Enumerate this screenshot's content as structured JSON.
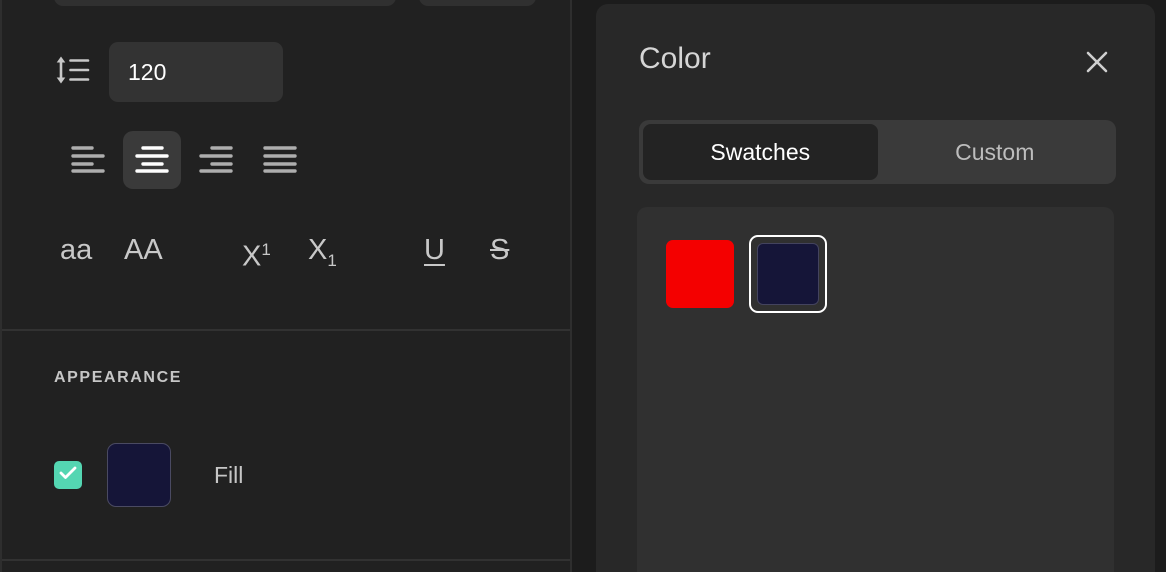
{
  "theme": {
    "app_background": "#1c1c1c",
    "panel_background": "#212121",
    "color_panel_background": "#282828",
    "accent_checkbox": "#54d6b2",
    "text_primary": "#ffffff",
    "text_secondary": "#c6c6c6"
  },
  "inspector": {
    "typography": {
      "line_height_icon": "line-height-icon",
      "line_height_value": "120",
      "line_height_placeholder": "120",
      "alignment": {
        "selected": "center",
        "options": [
          {
            "id": "left",
            "label": "Align left",
            "icon": "align-left-icon",
            "active": false
          },
          {
            "id": "center",
            "label": "Align center",
            "icon": "align-center-icon",
            "active": true
          },
          {
            "id": "right",
            "label": "Align right",
            "icon": "align-right-icon",
            "active": false
          },
          {
            "id": "justify",
            "label": "Justify",
            "icon": "align-justify-icon",
            "active": false
          }
        ]
      },
      "text_styles": [
        {
          "id": "lowercase",
          "label": "aa",
          "icon": "lowercase-icon"
        },
        {
          "id": "uppercase",
          "label": "AA",
          "icon": "uppercase-icon"
        },
        {
          "id": "superscript",
          "base": "X",
          "script": "1",
          "icon": "superscript-icon"
        },
        {
          "id": "subscript",
          "base": "X",
          "script": "1",
          "icon": "subscript-icon"
        },
        {
          "id": "underline",
          "label": "U",
          "icon": "underline-icon"
        },
        {
          "id": "strikethrough",
          "label": "S",
          "icon": "strikethrough-icon"
        }
      ]
    },
    "appearance": {
      "title": "APPEARANCE",
      "fill": {
        "label": "Fill",
        "enabled": true,
        "checkbox_icon": "check-icon",
        "swatch_color": "#151538"
      }
    }
  },
  "color_panel": {
    "title": "Color",
    "close_icon": "close-icon",
    "tabs": [
      {
        "id": "swatches",
        "label": "Swatches",
        "active": true
      },
      {
        "id": "custom",
        "label": "Custom",
        "active": false
      }
    ],
    "swatches": [
      {
        "id": "red",
        "color": "#f40000",
        "selected": false
      },
      {
        "id": "navy",
        "color": "#151538",
        "selected": true
      }
    ]
  }
}
